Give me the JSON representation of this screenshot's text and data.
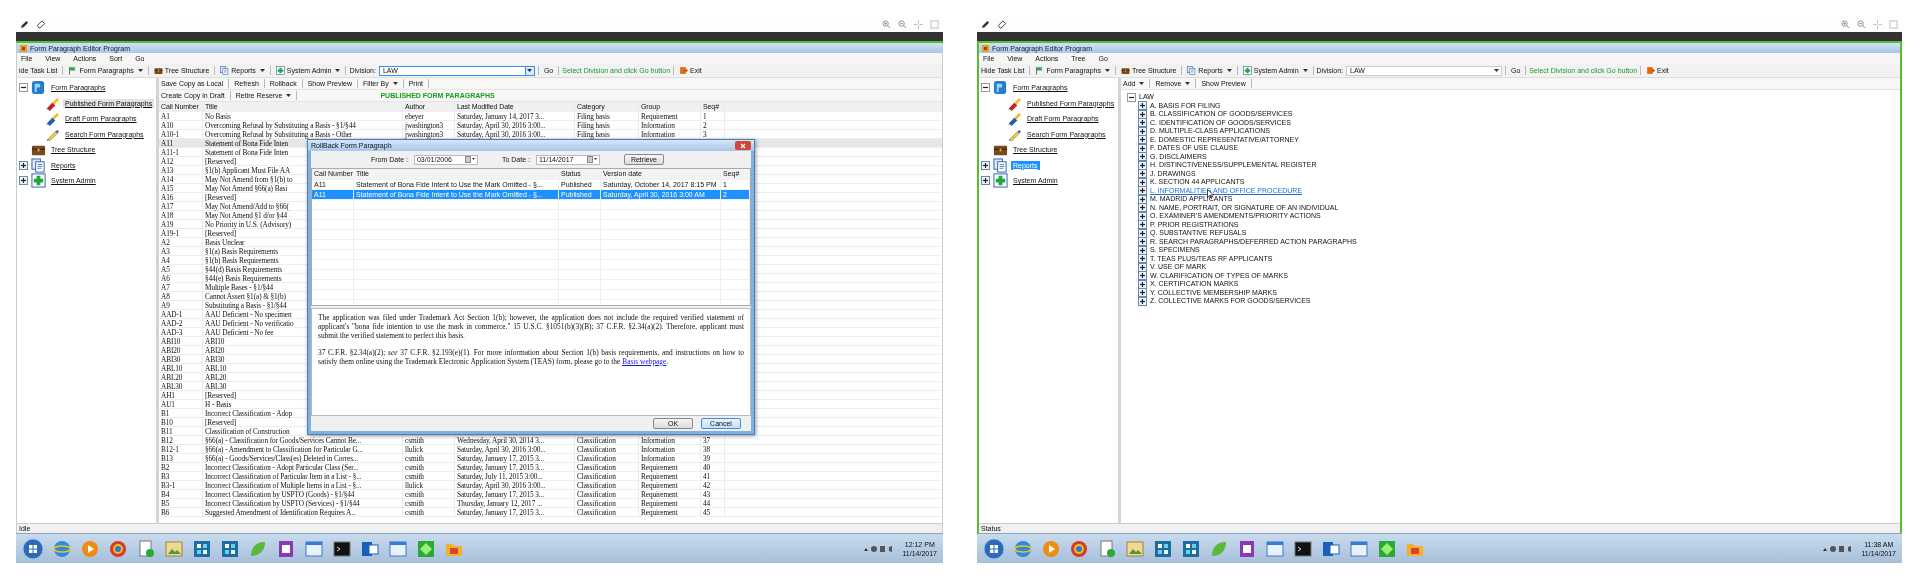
{
  "screens": [
    {
      "title": "Form Paragraph Editor Program",
      "frame_highlighted": false,
      "nav_focused": false,
      "menu": [
        "File",
        "View",
        "Actions",
        "Sort",
        "Go"
      ],
      "toolbar": {
        "hide_task_list": "ide Task List",
        "menus": [
          {
            "label": "Form Paragraphs",
            "dropdown": true
          },
          {
            "label": "Tree Structure",
            "dropdown": false
          },
          {
            "label": "Reports",
            "dropdown": true
          },
          {
            "label": "System Admin",
            "dropdown": true
          }
        ],
        "division": {
          "label": "Division:",
          "value": "LAW",
          "focused": true
        },
        "go": "Go",
        "hint": "Select Division and click Go button",
        "exit": "Exit"
      },
      "nav": [
        {
          "kind": "paragraphs",
          "label": "Form Paragraphs",
          "expanded": true,
          "selected": false,
          "children": [
            {
              "kind": "published",
              "label": "Published Form Paragraphs",
              "selected": true
            },
            {
              "kind": "draft",
              "label": "Draft Form Paragraphs",
              "selected": false
            },
            {
              "kind": "search",
              "label": "Search Form Paragraphs",
              "selected": false
            }
          ]
        },
        {
          "kind": "structure",
          "label": "Tree Structure",
          "selected": false
        },
        {
          "kind": "reports",
          "label": "Reports",
          "expanded": false,
          "selected": false
        },
        {
          "kind": "admin",
          "label": "System Admin",
          "expanded": false,
          "selected": false
        }
      ],
      "content": {
        "kind": "table",
        "actions": [
          [
            {
              "label": "Save Copy as Local",
              "dropdown": false
            },
            {
              "label": "Refresh",
              "dropdown": false
            },
            {
              "label": "Rollback",
              "dropdown": false
            },
            {
              "label": "Show Preview",
              "dropdown": false
            },
            {
              "label": "Filter By",
              "dropdown": true
            },
            {
              "label": "Print",
              "dropdown": false
            }
          ],
          [
            {
              "label": "Create Copy in Draft",
              "dropdown": false
            },
            {
              "label": "Retire Reserve",
              "dropdown": true
            }
          ]
        ],
        "heading": "PUBLISHED FORM PARAGRAPHS",
        "columns": [
          "Call Number",
          "Title",
          "Author",
          "Last Modified Date",
          "Category",
          "Group",
          "Seq#"
        ],
        "rows": [
          {
            "cells": [
              "A1",
              "No Basis",
              "ebeyer",
              "Saturday, January 14, 2017 3...",
              "Filing basis",
              "Requirement",
              "1"
            ],
            "selected": false
          },
          {
            "cells": [
              "A10",
              "Overcoming Refusal by Substituting a Basis - §1/§44",
              "jwashington3",
              "Saturday, April 30, 2016 3:00...",
              "Filing basis",
              "Information",
              "2"
            ],
            "selected": false
          },
          {
            "cells": [
              "A10-1",
              "Overcoming Refusal by Substituting a Basis - Other",
              "jwashington3",
              "Saturday, April 30, 2016 3:00...",
              "Filing basis",
              "Information",
              "3"
            ],
            "selected": false
          },
          {
            "cells": [
              "A11",
              "Statement of Bona Fide Inten"
            ],
            "selected": true
          },
          {
            "cells": [
              "A11-1",
              "Statement of Bona Fide Inten"
            ],
            "selected": false
          },
          {
            "cells": [
              "A12",
              "[Reserved]"
            ],
            "selected": false
          },
          {
            "cells": [
              "A13",
              "§1(b) Applicant Must File AA"
            ],
            "selected": false
          },
          {
            "cells": [
              "A14",
              "May Not Amend from §1(b) to"
            ],
            "selected": false
          },
          {
            "cells": [
              "A15",
              "May Not Amend §66(a) Basi"
            ],
            "selected": false
          },
          {
            "cells": [
              "A16",
              "[Reserved]"
            ],
            "selected": false
          },
          {
            "cells": [
              "A17",
              "May Not Amend/Add to §66("
            ],
            "selected": false
          },
          {
            "cells": [
              "A18",
              "May Not Amend §1 d/or §44"
            ],
            "selected": false
          },
          {
            "cells": [
              "A19",
              "No Priority in U.S. (Advisory)"
            ],
            "selected": false
          },
          {
            "cells": [
              "A19-1",
              "[Reserved]"
            ],
            "selected": false
          },
          {
            "cells": [
              "A2",
              "Basis Unclear"
            ],
            "selected": false
          },
          {
            "cells": [
              "A3",
              "§1(a) Basis Requirements"
            ],
            "selected": false
          },
          {
            "cells": [
              "A4",
              "§1(b) Basis Requirements"
            ],
            "selected": false
          },
          {
            "cells": [
              "A5",
              "§44(d) Basis Requirements"
            ],
            "selected": false
          },
          {
            "cells": [
              "A6",
              "§44(e) Basis Requirements"
            ],
            "selected": false
          },
          {
            "cells": [
              "A7",
              "Multiple Bases - §1/§44"
            ],
            "selected": false
          },
          {
            "cells": [
              "A8",
              "Cannot Assert §1(a) & §1(b)"
            ],
            "selected": false
          },
          {
            "cells": [
              "A9",
              "Substituting a Basis - §1/§44"
            ],
            "selected": false
          },
          {
            "cells": [
              "AAD-1",
              "AAU Deficient - No specimen"
            ],
            "selected": false
          },
          {
            "cells": [
              "AAD-2",
              "AAU Deficient - No verificatio"
            ],
            "selected": false
          },
          {
            "cells": [
              "AAD-3",
              "AAU Deficient - No fee"
            ],
            "selected": false
          },
          {
            "cells": [
              "ABI10",
              "ABI10"
            ],
            "selected": false
          },
          {
            "cells": [
              "ABI20",
              "ABI20"
            ],
            "selected": false
          },
          {
            "cells": [
              "ABI30",
              "ABI30"
            ],
            "selected": false
          },
          {
            "cells": [
              "ABL10",
              "ABL10"
            ],
            "selected": false
          },
          {
            "cells": [
              "ABL20",
              "ABL20"
            ],
            "selected": false
          },
          {
            "cells": [
              "ABL30",
              "ABL30"
            ],
            "selected": false
          },
          {
            "cells": [
              "AH1",
              "[Reserved]"
            ],
            "selected": false
          },
          {
            "cells": [
              "AU1",
              "H - Basis"
            ],
            "selected": false
          },
          {
            "cells": [
              "B1",
              "Incorrect Classification - Adop"
            ],
            "selected": false
          },
          {
            "cells": [
              "B10",
              "[Reserved]"
            ],
            "selected": false
          },
          {
            "cells": [
              "B11",
              "Classification of Construction"
            ],
            "selected": false
          },
          {
            "cells": [
              "B12",
              "§66(a) - Classification for Goods/Services Cannot Be...",
              "csmith",
              "Wednesday, April 30, 2014 3...",
              "Classification",
              "Information",
              "37"
            ],
            "selected": false
          },
          {
            "cells": [
              "B12-1",
              "§66(a) - Amendment to Classification for Particular G...",
              "llulick",
              "Saturday, April 30, 2016 3:00...",
              "Classification",
              "Information",
              "38"
            ],
            "selected": false
          },
          {
            "cells": [
              "B13",
              "§66(a) - Goods/Services/Class(es) Deleted in Corres...",
              "csmith",
              "Saturday, January 17, 2015 3...",
              "Classification",
              "Information",
              "39"
            ],
            "selected": false
          },
          {
            "cells": [
              "B2",
              "Incorrect Classification - Adopt Particular Class (Ser...",
              "csmith",
              "Saturday, January 17, 2015 3...",
              "Classification",
              "Requirement",
              "40"
            ],
            "selected": false
          },
          {
            "cells": [
              "B3",
              "Incorrect Classification of Particular Item in a List - §...",
              "csmith",
              "Saturday, July 11, 2015 3:00...",
              "Classification",
              "Requirement",
              "41"
            ],
            "selected": false
          },
          {
            "cells": [
              "B3-1",
              "Incorrect Classification of Multiple Items in a List - §...",
              "llulick",
              "Saturday, April 30, 2016 3:00...",
              "Classification",
              "Requirement",
              "42"
            ],
            "selected": false
          },
          {
            "cells": [
              "B4",
              "Incorrect Classification by USPTO (Goods) - §1/§44",
              "csmith",
              "Saturday, January 17, 2015 3...",
              "Classification",
              "Requirement",
              "43"
            ],
            "selected": false
          },
          {
            "cells": [
              "B5",
              "Incorrect Classification by USPTO (Services) - §1/§44",
              "csmith",
              "Thursday, January 12, 2017 ...",
              "Classification",
              "Requirement",
              "44"
            ],
            "selected": false
          },
          {
            "cells": [
              "B6",
              "Suggested Amendment of Identification Requires A...",
              "csmith",
              "Saturday, January 17, 2015 3...",
              "Classification",
              "Requirement",
              "45"
            ],
            "selected": false
          }
        ]
      },
      "dialog": {
        "title": "RollBack Form Paragraph",
        "from_label": "From Date :",
        "from_value": "03/01/2006",
        "to_label": "To Date :",
        "to_value": "11/14/2017",
        "retrieve": "Retrieve",
        "columns": [
          "Call Number",
          "Title",
          "Status",
          "Version date",
          "Seq#"
        ],
        "rows": [
          {
            "cells": [
              "A11",
              "Statement of Bona Fide Intent to Use the Mark Omitted - §...",
              "Published",
              "Saturday, October 14, 2017 8:15 PM",
              "1"
            ],
            "selected": false
          },
          {
            "cells": [
              "A11",
              "Statement of Bona Fide Intent to Use the Mark Omitted - §...",
              "Published",
              "Saturday, April 30, 2016 3:00 AM",
              "2"
            ],
            "selected": true
          }
        ],
        "preview": [
          {
            "text": "The application was filed under Trademark Act Section 1(b); however, the application does not include the required verified statement of applicant's \"bona fide intention to use the mark in commerce.\"  15 U.S.C. §1051(b)(3)(B); 37 C.F.R. §2.34(a)(2).  Therefore, applicant must submit the verified statement to perfect this basis."
          },
          {
            "text": "37 C.F.R. §2.34(a)(2); *see* 37 C.F.R. §2.193(e)(1).  For more information about Section 1(b) basis requirements, and instructions on how to satisfy them online using the Trademark Electronic Application System (TEAS) form, please go to the ",
            "link": "Basis webpage",
            "after": "."
          }
        ],
        "buttons": [
          {
            "label": "OK",
            "focused": false
          },
          {
            "label": "Cancel",
            "focused": true
          }
        ]
      },
      "status": "Idle",
      "clock": {
        "time": "12:12 PM",
        "date": "11/14/2017"
      }
    },
    {
      "title": "Form Paragraph Editor Program",
      "frame_highlighted": true,
      "nav_focused": true,
      "menu": [
        "File",
        "View",
        "Actions",
        "Tree",
        "Go"
      ],
      "toolbar": {
        "hide_task_list": "Hide Task List",
        "menus": [
          {
            "label": "Form Paragraphs",
            "dropdown": true
          },
          {
            "label": "Tree Structure",
            "dropdown": false
          },
          {
            "label": "Reports",
            "dropdown": true
          },
          {
            "label": "System Admin",
            "dropdown": true
          }
        ],
        "division": {
          "label": "Division:",
          "value": "LAW",
          "focused": false
        },
        "go": "Go",
        "hint": "Select Division and click Go button",
        "exit": "Exit"
      },
      "nav": [
        {
          "kind": "paragraphs",
          "label": "Form Paragraphs",
          "expanded": true,
          "selected": false,
          "children": [
            {
              "kind": "published",
              "label": "Published Form Paragraphs",
              "selected": false
            },
            {
              "kind": "draft",
              "label": "Draft Form Paragraphs",
              "selected": false
            },
            {
              "kind": "search",
              "label": "Search Form Paragraphs",
              "selected": false
            }
          ]
        },
        {
          "kind": "structure",
          "label": "Tree Structure",
          "selected": false
        },
        {
          "kind": "reports",
          "label": "Reports",
          "expanded": false,
          "selected": true
        },
        {
          "kind": "admin",
          "label": "System Admin",
          "expanded": false,
          "selected": false
        }
      ],
      "content": {
        "kind": "outline",
        "actions": [
          [
            {
              "label": "Add",
              "dropdown": true
            },
            {
              "label": "Remove",
              "dropdown": true
            },
            {
              "label": "Show Preview",
              "dropdown": false
            }
          ]
        ],
        "root": {
          "label": "LAW",
          "expanded": true,
          "children": [
            {
              "label": "A. BASIS FOR FILING",
              "expanded": false,
              "hovered": false
            },
            {
              "label": "B. CLASSIFICATION OF GOODS/SERVICES",
              "expanded": false,
              "hovered": false
            },
            {
              "label": "C. IDENTIFICATION OF GOODS/SERVICES",
              "expanded": false,
              "hovered": false
            },
            {
              "label": "D. MULTIPLE-CLASS APPLICATIONS",
              "expanded": false,
              "hovered": false
            },
            {
              "label": "E. DOMESTIC REPRESENTATIVE/ATTORNEY",
              "expanded": false,
              "hovered": false
            },
            {
              "label": "F. DATES OF USE CLAUSE",
              "expanded": false,
              "hovered": false
            },
            {
              "label": "G. DISCLAIMERS",
              "expanded": false,
              "hovered": false
            },
            {
              "label": "H. DISTINCTIVENESS/SUPPLEMENTAL REGISTER",
              "expanded": false,
              "hovered": false
            },
            {
              "label": "J. DRAWINGS",
              "expanded": false,
              "hovered": false
            },
            {
              "label": "K. SECTION 44 APPLICANTS",
              "expanded": false,
              "hovered": false
            },
            {
              "label": "L. INFORMALITIES AND OFFICE PROCEDURE",
              "expanded": false,
              "hovered": true
            },
            {
              "label": "M. MADRID APPLICANTS",
              "expanded": false,
              "hovered": false
            },
            {
              "label": "N. NAME, PORTRAIT, OR SIGNATURE OF AN INDIVIDUAL",
              "expanded": false,
              "hovered": false
            },
            {
              "label": "O. EXAMINER'S AMENDMENTS/PRIORITY ACTIONS",
              "expanded": false,
              "hovered": false
            },
            {
              "label": "P. PRIOR REGISTRATIONS",
              "expanded": false,
              "hovered": false
            },
            {
              "label": "Q. SUBSTANTIVE REFUSALS",
              "expanded": false,
              "hovered": false
            },
            {
              "label": "R. SEARCH PARAGRAPHS/DEFERRED ACTION PARAGRAPHS",
              "expanded": false,
              "hovered": false
            },
            {
              "label": "S. SPECIMENS",
              "expanded": false,
              "hovered": false
            },
            {
              "label": "T. TEAS PLUS/TEAS RF APPLICANTS",
              "expanded": false,
              "hovered": false
            },
            {
              "label": "V. USE OF MARK",
              "expanded": false,
              "hovered": false
            },
            {
              "label": "W. CLARIFICATION OF TYPES OF MARKS",
              "expanded": false,
              "hovered": false
            },
            {
              "label": "X. CERTIFICATION MARKS",
              "expanded": false,
              "hovered": false
            },
            {
              "label": "Y. COLLECTIVE MEMBERSHIP MARKS",
              "expanded": false,
              "hovered": false
            },
            {
              "label": "Z. COLLECTIVE MARKS FOR GOODS/SERVICES",
              "expanded": false,
              "hovered": false
            }
          ]
        }
      },
      "status": "Status",
      "clock": {
        "time": "11:38 AM",
        "date": "11/14/2017"
      }
    }
  ]
}
